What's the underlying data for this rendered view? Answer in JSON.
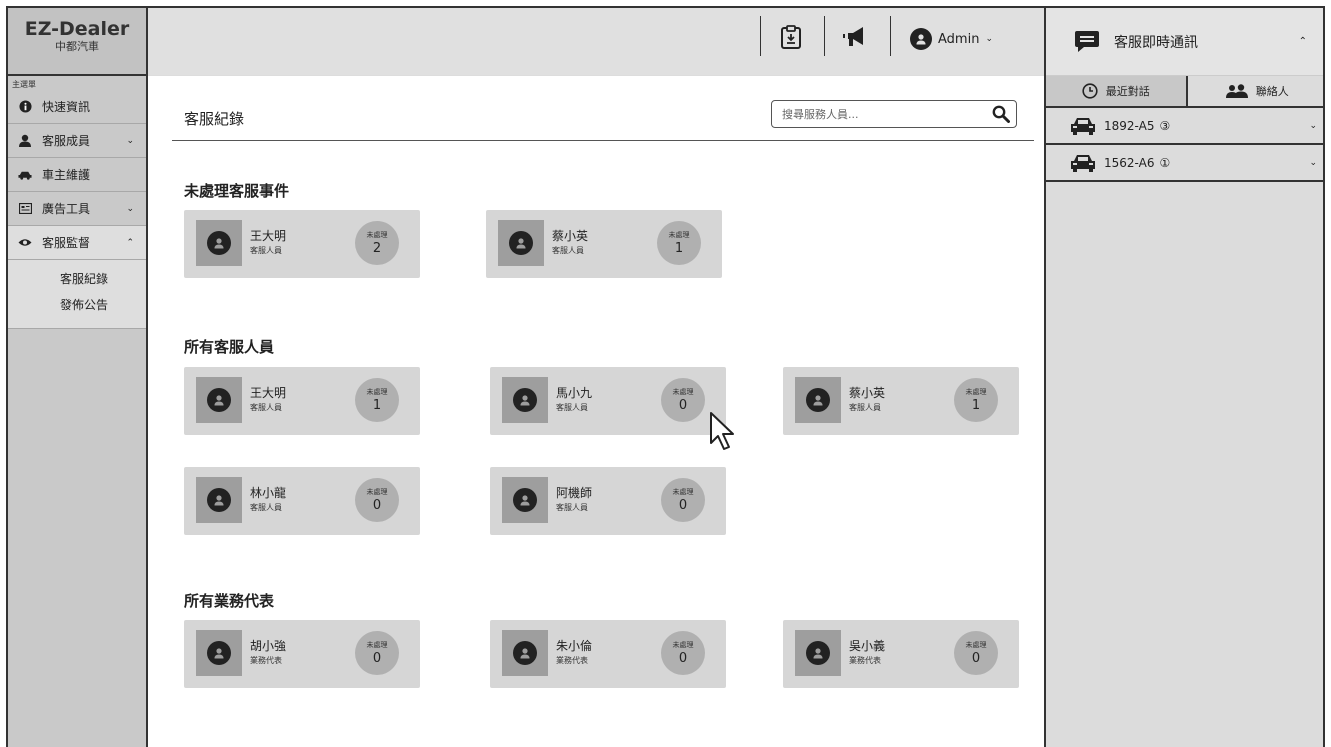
{
  "brand": {
    "name": "EZ-Dealer",
    "subtitle": "中都汽車"
  },
  "sidebar": {
    "caption": "主選單",
    "items": [
      {
        "label": "快速資訊",
        "icon": "info-icon",
        "chevron": ""
      },
      {
        "label": "客服成員",
        "icon": "person-icon",
        "chevron": "⌄"
      },
      {
        "label": "車主維護",
        "icon": "car-icon",
        "chevron": ""
      },
      {
        "label": "廣告工具",
        "icon": "ad-icon",
        "chevron": "⌄"
      },
      {
        "label": "客服監督",
        "icon": "eye-icon",
        "chevron": "⌃"
      }
    ],
    "submenu": [
      "客服紀錄",
      "發佈公告"
    ]
  },
  "topbar": {
    "icons": [
      "clipboard-icon",
      "megaphone-icon"
    ],
    "user": {
      "name": "Admin",
      "chevron": "⌄"
    }
  },
  "main": {
    "title": "客服紀錄",
    "search_placeholder": "搜尋服務人員...",
    "pending_label": "未處理",
    "sections": [
      {
        "title": "未處理客服事件",
        "cards": [
          {
            "name": "王大明",
            "role": "客服人員",
            "count": "2"
          },
          {
            "name": "蔡小英",
            "role": "客服人員",
            "count": "1"
          }
        ]
      },
      {
        "title": "所有客服人員",
        "cards": [
          {
            "name": "王大明",
            "role": "客服人員",
            "count": "1"
          },
          {
            "name": "馬小九",
            "role": "客服人員",
            "count": "0"
          },
          {
            "name": "蔡小英",
            "role": "客服人員",
            "count": "1"
          },
          {
            "name": "林小龍",
            "role": "客服人員",
            "count": "0"
          },
          {
            "name": "阿機師",
            "role": "客服人員",
            "count": "0"
          }
        ]
      },
      {
        "title": "所有業務代表",
        "cards": [
          {
            "name": "胡小強",
            "role": "業務代表",
            "count": "0"
          },
          {
            "name": "朱小倫",
            "role": "業務代表",
            "count": "0"
          },
          {
            "name": "吳小義",
            "role": "業務代表",
            "count": "0"
          }
        ]
      }
    ]
  },
  "chat": {
    "title": "客服即時通訊",
    "tabs": [
      {
        "label": "最近對話",
        "icon": "clock-icon"
      },
      {
        "label": "聯絡人",
        "icon": "contacts-icon"
      }
    ],
    "conversations": [
      {
        "plate": "1892-A5",
        "unread": "③"
      },
      {
        "plate": "1562-A6",
        "unread": "①"
      }
    ]
  },
  "colors": {
    "sidebar_bg": "#c9c9c9",
    "card_bg": "#d6d6d6",
    "badge_bg": "#b0b0b0",
    "topbar_bg": "#e0e0e0"
  }
}
